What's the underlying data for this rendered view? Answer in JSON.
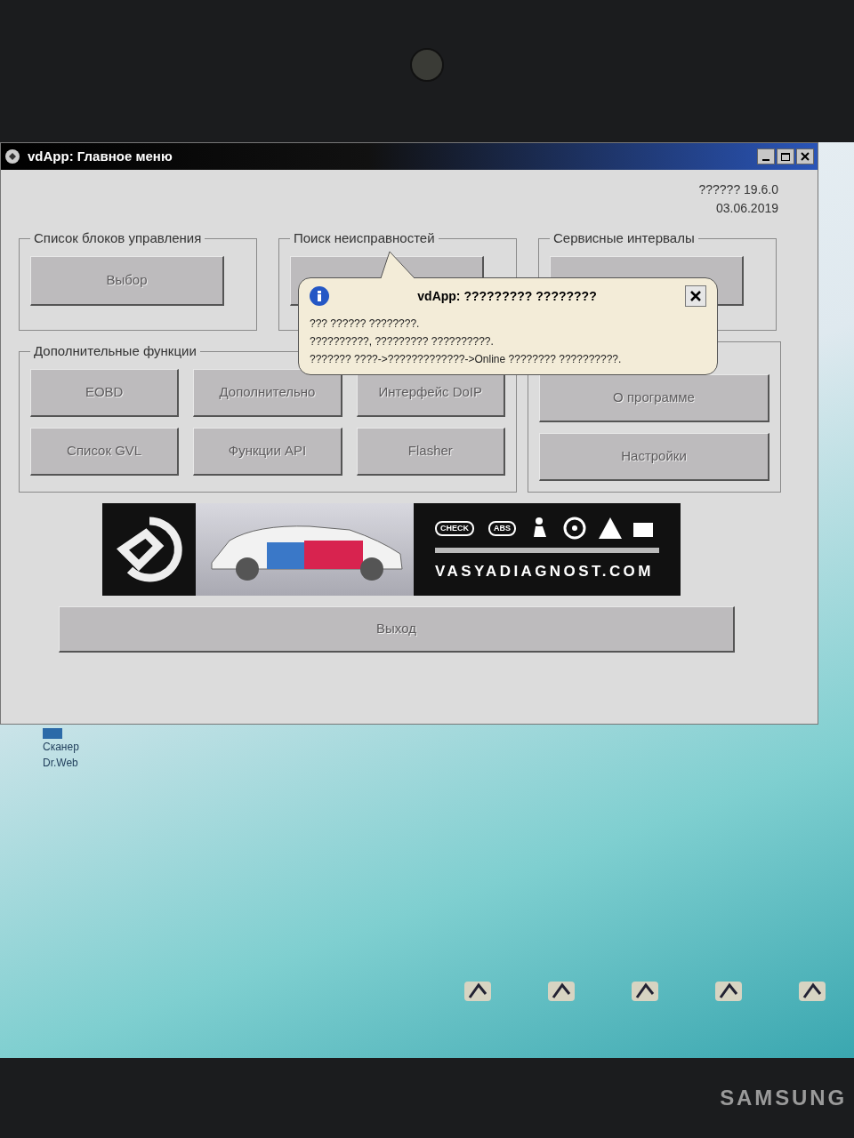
{
  "window": {
    "title": "vdApp: Главное меню",
    "version": "?????? 19.6.0",
    "date": "03.06.2019"
  },
  "groups_top": [
    {
      "title": "Список блоков управления",
      "buttons": [
        {
          "label": "Выбор",
          "disabled": true
        }
      ]
    },
    {
      "title": "Поиск неисправностей",
      "buttons": [
        {
          "disabled": true
        }
      ]
    },
    {
      "title": "Сервисные интервалы",
      "buttons": [
        {
          "disabled": true
        }
      ]
    }
  ],
  "extra_functions": {
    "title": "Дополнительные функции",
    "buttons": [
      {
        "label": "EOBD",
        "disabled": true
      },
      {
        "label": "Дополнительно",
        "disabled": true
      },
      {
        "label": "Интерфейс DoIP",
        "disabled": true
      },
      {
        "label": "Список GVL",
        "disabled": true
      },
      {
        "label": "Функции API",
        "disabled": true
      },
      {
        "label": "Flasher",
        "disabled": true
      }
    ]
  },
  "settings_group": {
    "buttons": [
      {
        "label": "О программе",
        "disabled": true
      },
      {
        "label": "Настройки",
        "disabled": true
      }
    ]
  },
  "banner": {
    "badges": [
      "CHECK",
      "ABS"
    ],
    "text": "VASYADIAGNOST.COM"
  },
  "exit_button": {
    "label": "Выход",
    "disabled": true
  },
  "balloon": {
    "title": "vdApp: ????????? ????????",
    "lines": [
      "??? ?????? ????????.",
      "??????????, ????????? ??????????.",
      "??????? ????->?????????????->Online ???????? ??????????."
    ]
  },
  "desktop_icon": {
    "lines": [
      "Сканер",
      "Dr.Web"
    ]
  },
  "bezel": {
    "brand": "SAMSUNG"
  }
}
